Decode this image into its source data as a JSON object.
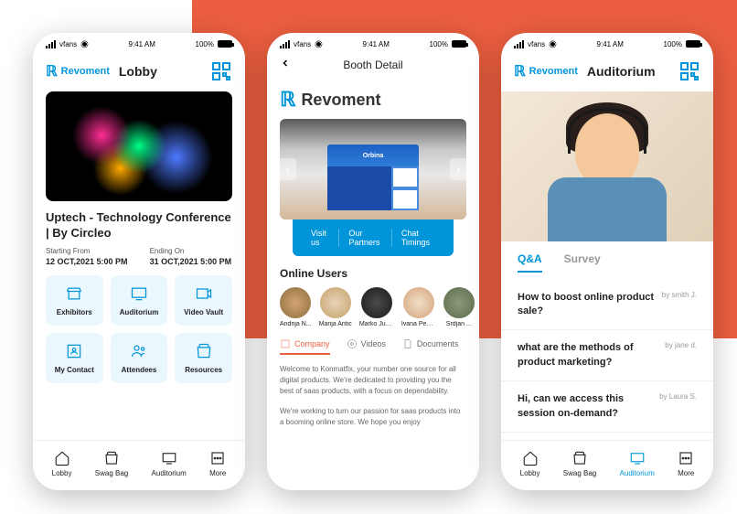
{
  "statusBar": {
    "carrier": "vfans",
    "time": "9:41 AM",
    "battery": "100%"
  },
  "brand": "Revoment",
  "phone1": {
    "headerTitle": "Lobby",
    "eventTitle": "Uptech - Technology Conference | By Circleo",
    "startLabel": "Starting From",
    "startValue": "12 OCT,2021  5:00 PM",
    "endLabel": "Ending On",
    "endValue": "31 OCT,2021  5:00 PM",
    "grid": [
      "Exhibitors",
      "Auditorium",
      "Video Vault",
      "My Contact",
      "Attendees",
      "Resources"
    ],
    "nav": [
      "Lobby",
      "Swag Bag",
      "Auditorium",
      "More"
    ]
  },
  "phone2": {
    "headerTitle": "Booth Detail",
    "boothName": "Revoment",
    "kioskLabel": "Orbina",
    "actions": [
      "Visit us",
      "Our Partners",
      "Chat Timings"
    ],
    "onlineTitle": "Online Users",
    "users": [
      "Andrija N...",
      "Marija Antic",
      "Marko Jus...",
      "Ivana Pesi...",
      "Srdjan ..."
    ],
    "tabs": [
      "Company",
      "Videos",
      "Documents"
    ],
    "body1": "Welcome to Konmatfix, your number one source for all digital products. We're dedicated to providing you the best of saas products, with a focus on dependability.",
    "body2": "We're working to turn our passion for saas products into a booming online store. We hope you enjoy"
  },
  "phone3": {
    "headerTitle": "Auditorium",
    "tabs": [
      "Q&A",
      "Survey"
    ],
    "qa": [
      {
        "q": "How to boost online product sale?",
        "by": "by smith J."
      },
      {
        "q": "what are the methods of product marketing?",
        "by": "by jane d."
      },
      {
        "q": "Hi, can we access this session on-demand?",
        "by": "by Laura S."
      }
    ],
    "nav": [
      "Lobby",
      "Swag Bag",
      "Auditorium",
      "More"
    ]
  }
}
